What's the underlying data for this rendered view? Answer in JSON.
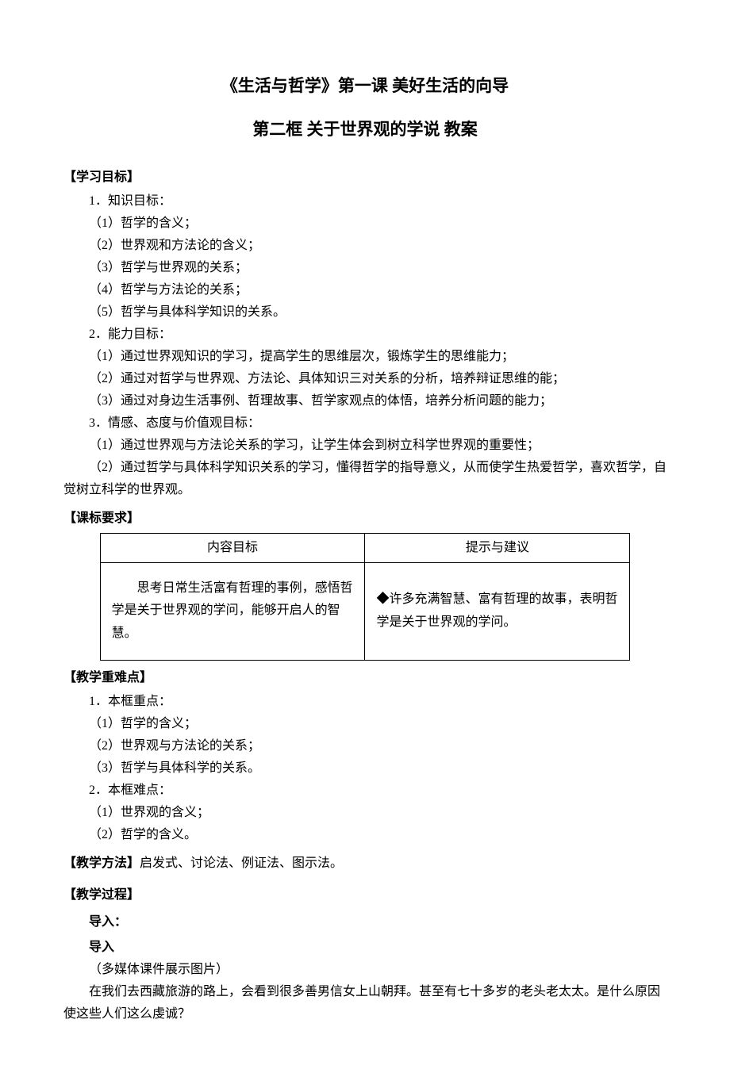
{
  "title": "《生活与哲学》第一课 美好生活的向导",
  "subtitle": "第二框 关于世界观的学说 教案",
  "sections": {
    "objectives": {
      "heading": "【学习目标】",
      "knowledge": {
        "label": "1．知识目标：",
        "items": [
          "（1）哲学的含义；",
          "（2）世界观和方法论的含义；",
          "（3）哲学与世界观的关系；",
          "（4）哲学与方法论的关系；",
          "（5）哲学与具体科学知识的关系。"
        ]
      },
      "ability": {
        "label": "2．能力目标：",
        "items": [
          "（1）通过世界观知识的学习，提高学生的思维层次，锻炼学生的思维能力；",
          "（2）通过对哲学与世界观、方法论、具体知识三对关系的分析，培养辩证思维的能；",
          "（3）通过对身边生活事例、哲理故事、哲学家观点的体悟，培养分析问题的能力；"
        ]
      },
      "emotion": {
        "label": "3．情感、态度与价值观目标：",
        "items": [
          "（1）通过世界观与方法论关系的学习，让学生体会到树立科学世界观的重要性；",
          "（2）通过哲学与具体科学知识关系的学习，懂得哲学的指导意义，从而使学生热爱哲学，喜欢哲学，自觉树立科学的世界观。"
        ]
      }
    },
    "standards": {
      "heading": "【课标要求】",
      "table": {
        "headers": [
          "内容目标",
          "提示与建议"
        ],
        "row": {
          "left": "思考日常生活富有哲理的事例，感悟哲学是关于世界观的学问，能够开启人的智慧。",
          "right": "◆许多充满智慧、富有哲理的故事，表明哲学是关于世界观的学问。"
        }
      }
    },
    "keypoints": {
      "heading": "【教学重难点】",
      "focus": {
        "label": "1．本框重点：",
        "items": [
          "（1）哲学的含义；",
          "（2）世界观与方法论的关系；",
          "（3）哲学与具体科学的关系。"
        ]
      },
      "difficulty": {
        "label": "2．本框难点：",
        "items": [
          "（1）世界观的含义；",
          "（2）哲学的含义。"
        ]
      }
    },
    "methods": {
      "heading": "【教学方法】",
      "text": "启发式、讨论法、例证法、图示法。"
    },
    "process": {
      "heading": "【教学过程】",
      "intro1": "导入：",
      "intro2": "导入",
      "lines": [
        "（多媒体课件展示图片）",
        "在我们去西藏旅游的路上，会看到很多善男信女上山朝拜。甚至有七十多岁的老头老太太。是什么原因使这些人们这么虔诚？"
      ]
    }
  }
}
